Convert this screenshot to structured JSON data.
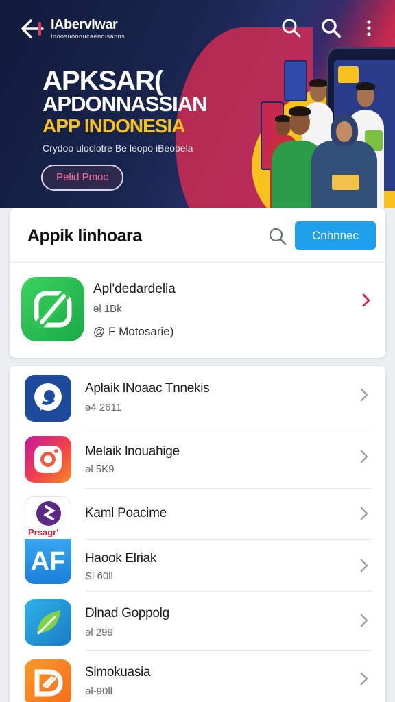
{
  "header": {
    "brand_name": "IAbervlwar",
    "brand_tagline": "Inoosuoonucaenoisanns",
    "icons": [
      "back-arrow-icon",
      "search-icon",
      "search-icon",
      "more-vertical-icon"
    ]
  },
  "hero": {
    "line1": "APKSAR(",
    "line2": "APDONNASSIAN",
    "line3": "APP INDONESIA",
    "subtitle": "Crydoo uloclotre Be leopo iBeobela",
    "button_label": "Pelid Pmoc",
    "accent_yellow": "#f6c21b",
    "accent_red": "#d02b52"
  },
  "section": {
    "title": "Appik linhoara",
    "search_icon": "search-icon",
    "connect_label": "Cnhnnec",
    "accent": "#1ea0ec"
  },
  "featured": {
    "name": "Apl'dedardelia",
    "meta": "ǝl 1Bk",
    "developer": "@ F Motosarie)",
    "icon_color": "#2dc653",
    "chevron_color": "#d62b5a"
  },
  "apps": [
    {
      "title": "Aplaik lNoaac Tnnekis",
      "meta": "ǝ4 2611",
      "icon": "blue-chat-icon"
    },
    {
      "title": "Melaik lnouahige",
      "meta": "ǝl 5K9",
      "icon": "camera-icon"
    },
    {
      "title": "Kaml Poacime",
      "meta": "",
      "icon": "purple-app-icon",
      "icon_caption": "Prsagr'"
    },
    {
      "title": "Haook Elriak",
      "meta": "Sl 60ll",
      "icon": "af-icon",
      "icon_text": "AF"
    },
    {
      "title": "Dlnad Goppolg",
      "meta": "ǝl 299",
      "icon": "leaf-icon"
    },
    {
      "title": "Simokuasia",
      "meta": "ǝl-90ll",
      "icon": "orange-d-icon"
    }
  ]
}
